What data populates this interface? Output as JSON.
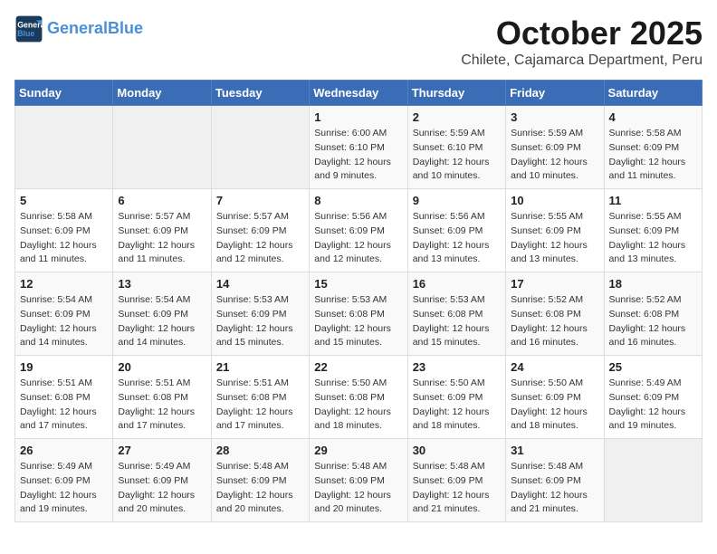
{
  "header": {
    "logo_line1": "General",
    "logo_line2": "Blue",
    "title": "October 2025",
    "subtitle": "Chilete, Cajamarca Department, Peru"
  },
  "calendar": {
    "headers": [
      "Sunday",
      "Monday",
      "Tuesday",
      "Wednesday",
      "Thursday",
      "Friday",
      "Saturday"
    ],
    "weeks": [
      {
        "days": [
          {
            "num": "",
            "info": ""
          },
          {
            "num": "",
            "info": ""
          },
          {
            "num": "",
            "info": ""
          },
          {
            "num": "1",
            "info": "Sunrise: 6:00 AM\nSunset: 6:10 PM\nDaylight: 12 hours\nand 9 minutes."
          },
          {
            "num": "2",
            "info": "Sunrise: 5:59 AM\nSunset: 6:10 PM\nDaylight: 12 hours\nand 10 minutes."
          },
          {
            "num": "3",
            "info": "Sunrise: 5:59 AM\nSunset: 6:09 PM\nDaylight: 12 hours\nand 10 minutes."
          },
          {
            "num": "4",
            "info": "Sunrise: 5:58 AM\nSunset: 6:09 PM\nDaylight: 12 hours\nand 11 minutes."
          }
        ]
      },
      {
        "days": [
          {
            "num": "5",
            "info": "Sunrise: 5:58 AM\nSunset: 6:09 PM\nDaylight: 12 hours\nand 11 minutes."
          },
          {
            "num": "6",
            "info": "Sunrise: 5:57 AM\nSunset: 6:09 PM\nDaylight: 12 hours\nand 11 minutes."
          },
          {
            "num": "7",
            "info": "Sunrise: 5:57 AM\nSunset: 6:09 PM\nDaylight: 12 hours\nand 12 minutes."
          },
          {
            "num": "8",
            "info": "Sunrise: 5:56 AM\nSunset: 6:09 PM\nDaylight: 12 hours\nand 12 minutes."
          },
          {
            "num": "9",
            "info": "Sunrise: 5:56 AM\nSunset: 6:09 PM\nDaylight: 12 hours\nand 13 minutes."
          },
          {
            "num": "10",
            "info": "Sunrise: 5:55 AM\nSunset: 6:09 PM\nDaylight: 12 hours\nand 13 minutes."
          },
          {
            "num": "11",
            "info": "Sunrise: 5:55 AM\nSunset: 6:09 PM\nDaylight: 12 hours\nand 13 minutes."
          }
        ]
      },
      {
        "days": [
          {
            "num": "12",
            "info": "Sunrise: 5:54 AM\nSunset: 6:09 PM\nDaylight: 12 hours\nand 14 minutes."
          },
          {
            "num": "13",
            "info": "Sunrise: 5:54 AM\nSunset: 6:09 PM\nDaylight: 12 hours\nand 14 minutes."
          },
          {
            "num": "14",
            "info": "Sunrise: 5:53 AM\nSunset: 6:09 PM\nDaylight: 12 hours\nand 15 minutes."
          },
          {
            "num": "15",
            "info": "Sunrise: 5:53 AM\nSunset: 6:08 PM\nDaylight: 12 hours\nand 15 minutes."
          },
          {
            "num": "16",
            "info": "Sunrise: 5:53 AM\nSunset: 6:08 PM\nDaylight: 12 hours\nand 15 minutes."
          },
          {
            "num": "17",
            "info": "Sunrise: 5:52 AM\nSunset: 6:08 PM\nDaylight: 12 hours\nand 16 minutes."
          },
          {
            "num": "18",
            "info": "Sunrise: 5:52 AM\nSunset: 6:08 PM\nDaylight: 12 hours\nand 16 minutes."
          }
        ]
      },
      {
        "days": [
          {
            "num": "19",
            "info": "Sunrise: 5:51 AM\nSunset: 6:08 PM\nDaylight: 12 hours\nand 17 minutes."
          },
          {
            "num": "20",
            "info": "Sunrise: 5:51 AM\nSunset: 6:08 PM\nDaylight: 12 hours\nand 17 minutes."
          },
          {
            "num": "21",
            "info": "Sunrise: 5:51 AM\nSunset: 6:08 PM\nDaylight: 12 hours\nand 17 minutes."
          },
          {
            "num": "22",
            "info": "Sunrise: 5:50 AM\nSunset: 6:08 PM\nDaylight: 12 hours\nand 18 minutes."
          },
          {
            "num": "23",
            "info": "Sunrise: 5:50 AM\nSunset: 6:09 PM\nDaylight: 12 hours\nand 18 minutes."
          },
          {
            "num": "24",
            "info": "Sunrise: 5:50 AM\nSunset: 6:09 PM\nDaylight: 12 hours\nand 18 minutes."
          },
          {
            "num": "25",
            "info": "Sunrise: 5:49 AM\nSunset: 6:09 PM\nDaylight: 12 hours\nand 19 minutes."
          }
        ]
      },
      {
        "days": [
          {
            "num": "26",
            "info": "Sunrise: 5:49 AM\nSunset: 6:09 PM\nDaylight: 12 hours\nand 19 minutes."
          },
          {
            "num": "27",
            "info": "Sunrise: 5:49 AM\nSunset: 6:09 PM\nDaylight: 12 hours\nand 20 minutes."
          },
          {
            "num": "28",
            "info": "Sunrise: 5:48 AM\nSunset: 6:09 PM\nDaylight: 12 hours\nand 20 minutes."
          },
          {
            "num": "29",
            "info": "Sunrise: 5:48 AM\nSunset: 6:09 PM\nDaylight: 12 hours\nand 20 minutes."
          },
          {
            "num": "30",
            "info": "Sunrise: 5:48 AM\nSunset: 6:09 PM\nDaylight: 12 hours\nand 21 minutes."
          },
          {
            "num": "31",
            "info": "Sunrise: 5:48 AM\nSunset: 6:09 PM\nDaylight: 12 hours\nand 21 minutes."
          },
          {
            "num": "",
            "info": ""
          }
        ]
      }
    ]
  }
}
